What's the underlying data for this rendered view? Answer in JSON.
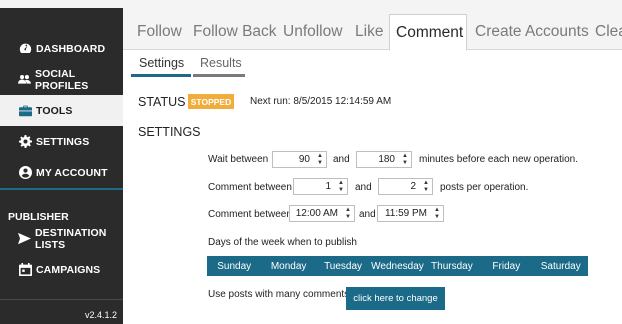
{
  "sidebar": {
    "items": [
      {
        "label": "DASHBOARD",
        "icon": "dashboard-icon"
      },
      {
        "label": "SOCIAL PROFILES",
        "icon": "users-icon"
      },
      {
        "label": "TOOLS",
        "icon": "briefcase-icon"
      },
      {
        "label": "SETTINGS",
        "icon": "gear-icon"
      },
      {
        "label": "MY ACCOUNT",
        "icon": "user-circle-icon"
      }
    ],
    "publisher_title": "PUBLISHER",
    "publisher_items": [
      {
        "label": "DESTINATION LISTS",
        "icon": "send-icon"
      },
      {
        "label": "CAMPAIGNS",
        "icon": "calendar-icon"
      }
    ],
    "version": "v2.4.1.2"
  },
  "tabs": [
    "Follow",
    "Follow Back",
    "Unfollow",
    "Like",
    "Comment",
    "Create Accounts",
    "Clea"
  ],
  "active_tab": "Comment",
  "subtabs": [
    "Settings",
    "Results"
  ],
  "status": {
    "label": "STATUS",
    "badge": "STOPPED",
    "next_run": "Next run: 8/5/2015 12:14:59 AM"
  },
  "settings": {
    "heading": "SETTINGS",
    "wait": {
      "prefix": "Wait between",
      "min": "90",
      "and": "and",
      "max": "180",
      "suffix": "minutes before each new operation."
    },
    "comment_count": {
      "prefix": "Comment between",
      "min": "1",
      "and": "and",
      "max": "2",
      "suffix": "posts per operation."
    },
    "comment_time": {
      "prefix": "Comment between",
      "start": "12:00 AM",
      "and": "and",
      "end": "11:59 PM"
    },
    "days_label": "Days of the week when to publish",
    "days": [
      "Sunday",
      "Monday",
      "Tuesday",
      "Wednesday",
      "Thursday",
      "Friday",
      "Saturday"
    ],
    "posts_label": "Use posts with many comments",
    "change_button": "click here to change"
  },
  "colors": {
    "sidebar": "#2b2b2b",
    "accent": "#1a6a88",
    "badge": "#f0ad3c"
  }
}
